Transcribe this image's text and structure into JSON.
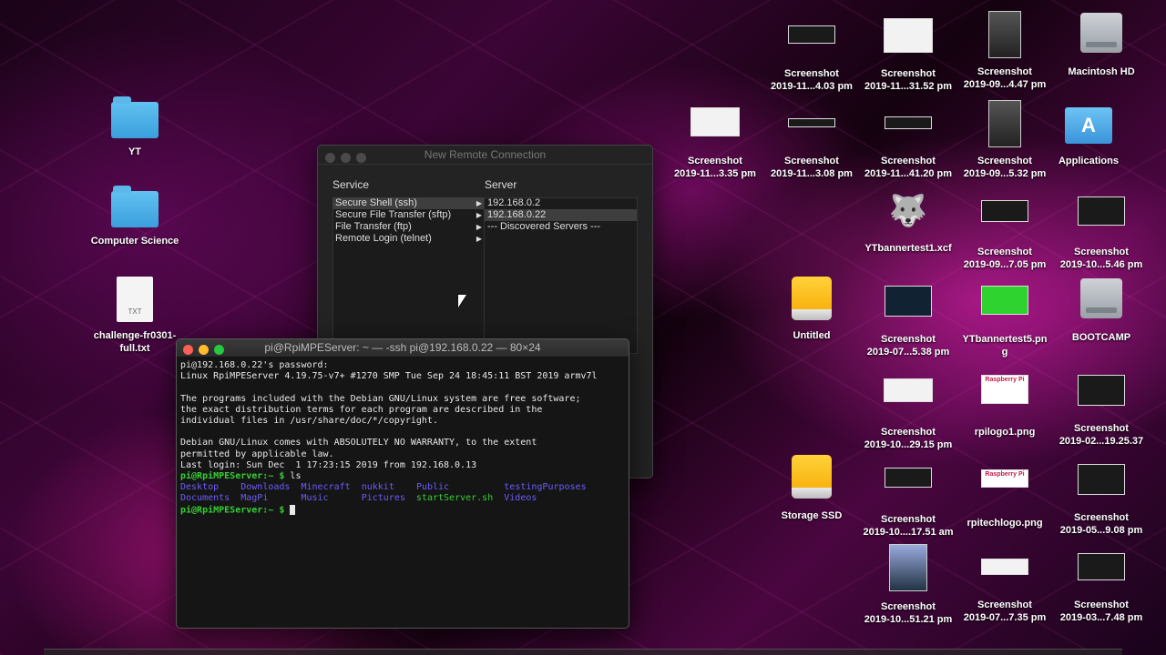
{
  "desktop_left": [
    {
      "label": "YT",
      "kind": "folder"
    },
    {
      "label": "Computer Science",
      "kind": "folder"
    },
    {
      "label": "challenge-fr0301-full.txt",
      "kind": "txt",
      "badge": "TXT"
    }
  ],
  "desktop_right": [
    {
      "line1": "Screenshot",
      "line2": "2019-11...4.03 pm"
    },
    {
      "line1": "Screenshot",
      "line2": "2019-11...31.52 pm"
    },
    {
      "line1": "Screenshot",
      "line2": "2019-09...4.47 pm"
    },
    {
      "line1": "Macintosh HD",
      "line2": ""
    },
    {
      "line1": "Screenshot",
      "line2": "2019-11...3.35 pm"
    },
    {
      "line1": "Screenshot",
      "line2": "2019-11...3.08 pm"
    },
    {
      "line1": "Screenshot",
      "line2": "2019-11...41.20 pm"
    },
    {
      "line1": "Screenshot",
      "line2": "2019-09...5.32 pm"
    },
    {
      "line1": "Applications",
      "line2": ""
    },
    {
      "line1": "YTbannertest1.xcf",
      "line2": ""
    },
    {
      "line1": "Screenshot",
      "line2": "2019-09...7.05 pm"
    },
    {
      "line1": "Screenshot",
      "line2": "2019-10...5.46 pm"
    },
    {
      "line1": "Untitled",
      "line2": ""
    },
    {
      "line1": "Screenshot",
      "line2": "2019-07...5.38 pm"
    },
    {
      "line1": "YTbannertest5.pn",
      "line2": "g"
    },
    {
      "line1": "BOOTCAMP",
      "line2": ""
    },
    {
      "line1": "Screenshot",
      "line2": "2019-10...29.15 pm"
    },
    {
      "line1": "rpilogo1.png",
      "line2": ""
    },
    {
      "line1": "Screenshot",
      "line2": "2019-02...19.25.37"
    },
    {
      "line1": "Storage SSD",
      "line2": ""
    },
    {
      "line1": "Screenshot",
      "line2": "2019-10....17.51 am"
    },
    {
      "line1": "rpitechlogo.png",
      "line2": ""
    },
    {
      "line1": "Screenshot",
      "line2": "2019-05...9.08 pm"
    },
    {
      "line1": "Screenshot",
      "line2": "2019-10...51.21 pm"
    },
    {
      "line1": "Screenshot",
      "line2": "2019-07...7.35 pm"
    },
    {
      "line1": "Screenshot",
      "line2": "2019-03...7.48 pm"
    }
  ],
  "rpi_thumb_text": "Raspberry Pi",
  "dialog": {
    "title": "New Remote Connection",
    "service_header": "Service",
    "server_header": "Server",
    "services": [
      "Secure Shell (ssh)",
      "Secure File Transfer (sftp)",
      "File Transfer (ftp)",
      "Remote Login (telnet)"
    ],
    "servers": [
      "192.168.0.2",
      "192.168.0.22",
      "--- Discovered Servers ---"
    ]
  },
  "terminal": {
    "title": "pi@RpiMPEServer: ~ — -ssh pi@192.168.0.22 — 80×24",
    "lines": [
      "pi@192.168.0.22's password:",
      "Linux RpiMPEServer 4.19.75-v7+ #1270 SMP Tue Sep 24 18:45:11 BST 2019 armv7l",
      "",
      "The programs included with the Debian GNU/Linux system are free software;",
      "the exact distribution terms for each program are described in the",
      "individual files in /usr/share/doc/*/copyright.",
      "",
      "Debian GNU/Linux comes with ABSOLUTELY NO WARRANTY, to the extent",
      "permitted by applicable law.",
      "Last login: Sun Dec  1 17:23:15 2019 from 192.168.0.13"
    ],
    "prompt": "pi@RpiMPEServer:~ $",
    "command": "ls",
    "ls_row1": [
      "Desktop",
      "Downloads",
      "Minecraft",
      "nukkit",
      "Public",
      "testingPurposes"
    ],
    "ls_row2": [
      "Documents",
      "MagPi",
      "Music",
      "Pictures",
      "startServer.sh",
      "Videos"
    ]
  }
}
